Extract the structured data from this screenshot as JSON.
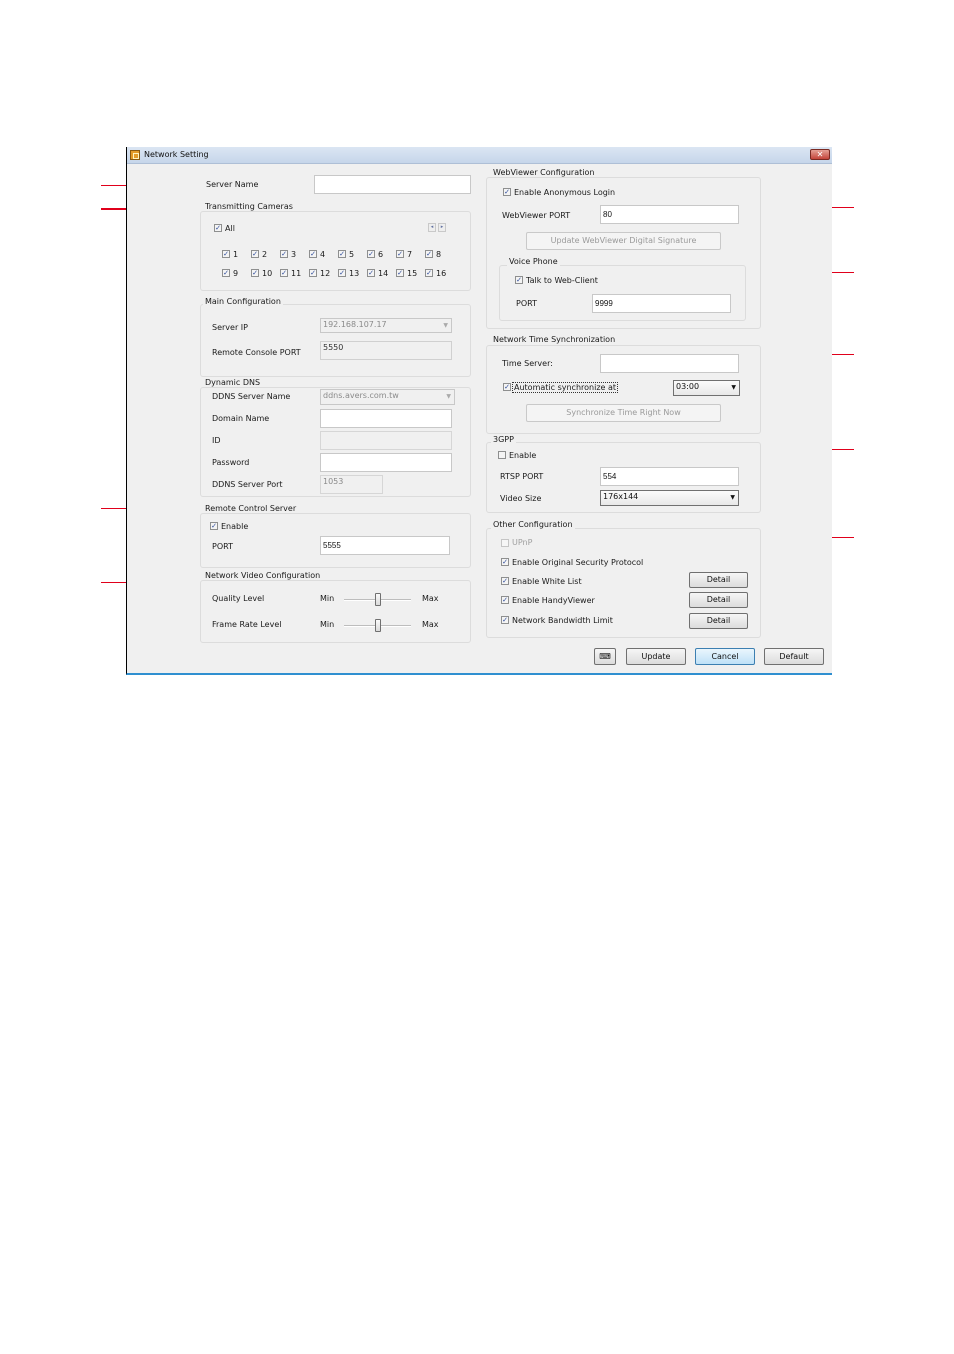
{
  "window": {
    "title": "Network Setting",
    "close_glyph": "✕"
  },
  "server_name": {
    "label": "Server Name",
    "value": ""
  },
  "transmitting_cameras": {
    "legend": "Transmitting Cameras",
    "all_label": "All",
    "all_checked": true,
    "prev_glyph": "◂",
    "next_glyph": "▸",
    "cameras": [
      {
        "label": "1",
        "checked": true
      },
      {
        "label": "2",
        "checked": true
      },
      {
        "label": "3",
        "checked": true
      },
      {
        "label": "4",
        "checked": true
      },
      {
        "label": "5",
        "checked": true
      },
      {
        "label": "6",
        "checked": true
      },
      {
        "label": "7",
        "checked": true
      },
      {
        "label": "8",
        "checked": true
      },
      {
        "label": "9",
        "checked": true
      },
      {
        "label": "10",
        "checked": true
      },
      {
        "label": "11",
        "checked": true
      },
      {
        "label": "12",
        "checked": true
      },
      {
        "label": "13",
        "checked": true
      },
      {
        "label": "14",
        "checked": true
      },
      {
        "label": "15",
        "checked": true
      },
      {
        "label": "16",
        "checked": true
      }
    ]
  },
  "main_configuration": {
    "legend": "Main Configuration",
    "server_ip_label": "Server IP",
    "server_ip_value": "192.168.107.17",
    "remote_console_port_label": "Remote Console PORT",
    "remote_console_port_value": "5550"
  },
  "dynamic_dns": {
    "legend": "Dynamic DNS",
    "server_name_label": "DDNS Server Name",
    "server_name_value": "ddns.avers.com.tw",
    "domain_name_label": "Domain Name",
    "domain_name_value": "",
    "id_label": "ID",
    "id_value": "",
    "password_label": "Password",
    "password_value": "",
    "server_port_label": "DDNS Server Port",
    "server_port_value": "1053"
  },
  "remote_control_server": {
    "legend": "Remote Control Server",
    "enable_label": "Enable",
    "enable_checked": true,
    "port_label": "PORT",
    "port_value": "5555"
  },
  "network_video_configuration": {
    "legend": "Network Video Configuration",
    "quality_label": "Quality Level",
    "quality_percent": 50,
    "frame_rate_label": "Frame Rate Level",
    "frame_rate_percent": 50,
    "min_label": "Min",
    "max_label": "Max"
  },
  "webviewer_configuration": {
    "legend": "WebViewer Configuration",
    "anonymous_label": "Enable Anonymous Login",
    "anonymous_checked": true,
    "port_label": "WebViewer PORT",
    "port_value": "80",
    "signature_button": "Update WebViewer Digital Signature",
    "voice_phone": {
      "legend": "Voice Phone",
      "talk_label": "Talk to Web-Client",
      "talk_checked": true,
      "port_label": "PORT",
      "port_value": "9999"
    }
  },
  "network_time_sync": {
    "legend": "Network Time Synchronization",
    "time_server_label": "Time Server:",
    "time_server_value": "",
    "auto_sync_label": "Automatic synchronize at",
    "auto_sync_checked": true,
    "auto_sync_time": "03:00",
    "sync_now_button": "Synchronize Time Right Now"
  },
  "gpp3": {
    "legend": "3GPP",
    "enable_label": "Enable",
    "enable_checked": false,
    "rtsp_port_label": "RTSP PORT",
    "rtsp_port_value": "554",
    "video_size_label": "Video Size",
    "video_size_value": "176x144"
  },
  "other_configuration": {
    "legend": "Other Configuration",
    "upnp_label": "UPnP",
    "original_security_label": "Enable Original Security Protocol",
    "white_list_label": "Enable White List",
    "handyviewer_label": "Enable HandyViewer",
    "bandwidth_label": "Network Bandwidth Limit",
    "detail_label": "Detail"
  },
  "footer": {
    "keyboard_glyph": "⌨",
    "update_label": "Update",
    "cancel_label": "Cancel",
    "default_label": "Default"
  },
  "colors": {
    "annotation": "#e0001b",
    "window_bg": "#f0f0f0",
    "focus_border": "#3c7fb1"
  }
}
